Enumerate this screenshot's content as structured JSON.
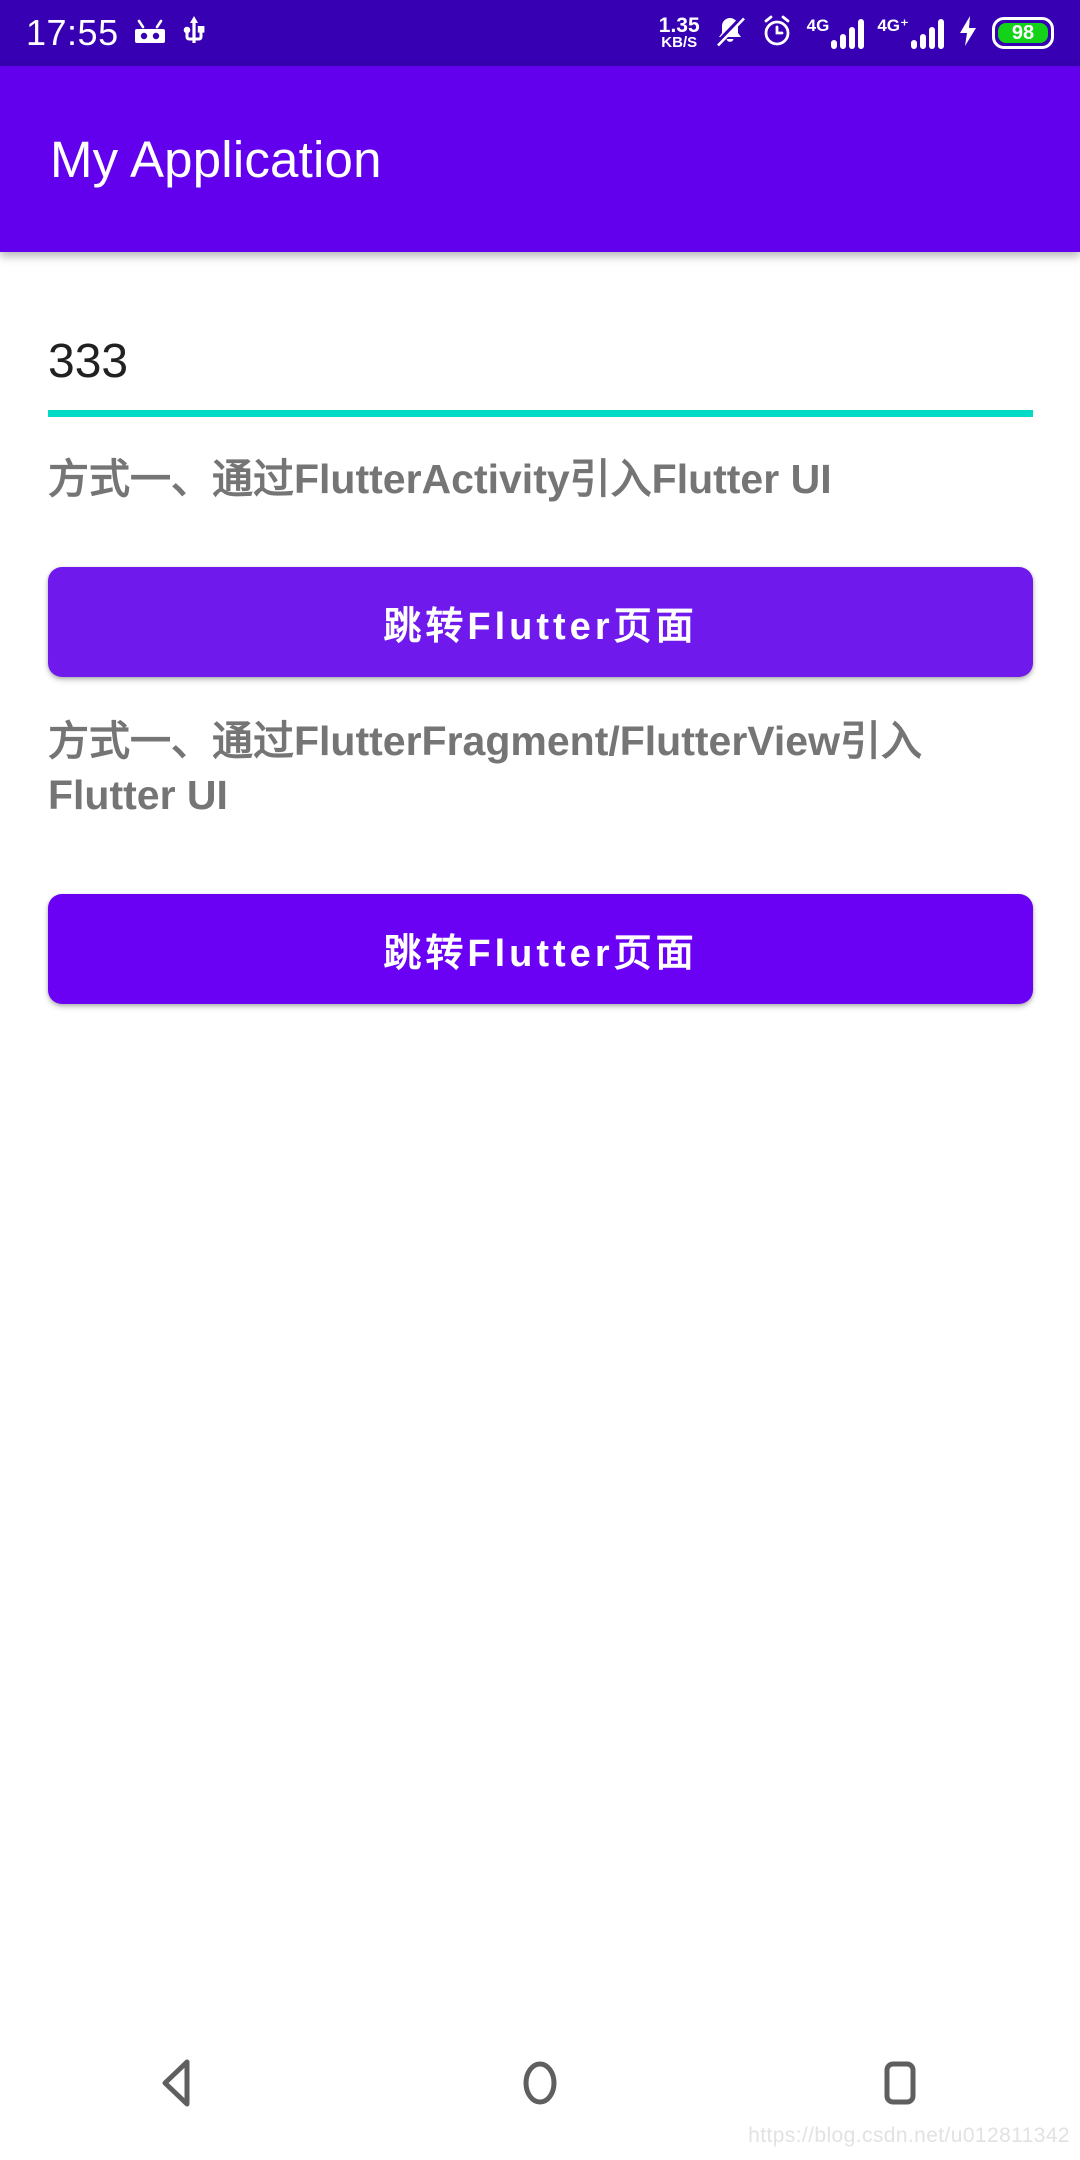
{
  "status_bar": {
    "time": "17:55",
    "icons_left": [
      "android-robot-icon",
      "usb-icon"
    ],
    "network_speed_value": "1.35",
    "network_speed_unit": "KB/S",
    "silent_icon": "bell-muted-icon",
    "alarm_icon": "alarm-clock-icon",
    "sim1_label": "4G",
    "sim2_label": "4G⁺",
    "charging_icon": "lightning-bolt-icon",
    "battery_percent": "98",
    "background_color": "#3700B3",
    "foreground_color": "#FFFFFF",
    "battery_fill_color": "#12D318"
  },
  "app_bar": {
    "title": "My Application",
    "background_color": "#6200EE",
    "title_color": "#FFFFFF"
  },
  "main": {
    "input": {
      "value": "333",
      "placeholder": "",
      "underline_color": "#03DAC5",
      "text_color": "#212121"
    },
    "sections": [
      {
        "label": "方式一、通过FlutterActivity引入Flutter UI",
        "button_label": "跳转Flutter页面"
      },
      {
        "label": "方式一、通过FlutterFragment/FlutterView引入Flutter UI",
        "button_label": "跳转Flutter页面"
      }
    ],
    "label_color": "#757575",
    "button_color": "#6F19ED",
    "button_text_color": "#FFFFFF"
  },
  "nav_bar": {
    "back_icon": "triangle-back-icon",
    "home_icon": "circle-home-icon",
    "recents_icon": "square-recents-icon",
    "icon_color": "#5F5F5F"
  },
  "watermark": {
    "text": "https://blog.csdn.net/u012811342"
  }
}
